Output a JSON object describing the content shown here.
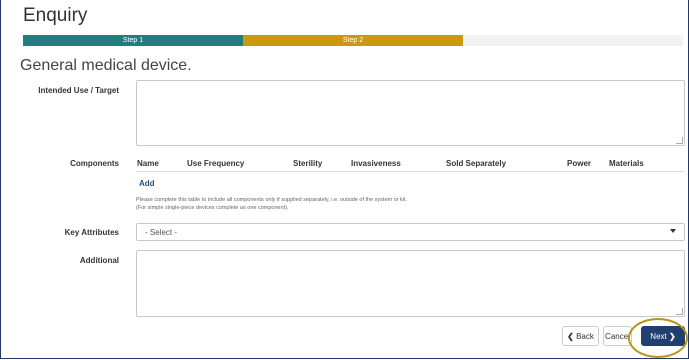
{
  "header": {
    "title": "Enquiry"
  },
  "steps": [
    {
      "label": "Step 1"
    },
    {
      "label": "Step 2"
    }
  ],
  "section": {
    "title": "General medical device."
  },
  "form": {
    "intended_use_label": "Intended Use / Target",
    "components_label": "Components",
    "components_columns": [
      "Name",
      "Use Frequency",
      "Sterility",
      "Invasiveness",
      "Sold Separately",
      "Power",
      "Materials"
    ],
    "add_label": "Add",
    "help_line1": "Please complete this table to include all components only if supplied separately, i.e. outside of the system or kit.",
    "help_line2": "(For simple single-piece devices complete as one component).",
    "key_attributes_label": "Key Attributes",
    "key_attributes_selected": "- Select -",
    "additional_label": "Additional"
  },
  "buttons": {
    "back_label": "Back",
    "cancel_label": "Cancel",
    "next_label": "Next"
  },
  "colors": {
    "step1": "#237d80",
    "step2": "#c99a0f",
    "primary": "#1f3f6e",
    "highlight_ring": "#b8941a"
  }
}
